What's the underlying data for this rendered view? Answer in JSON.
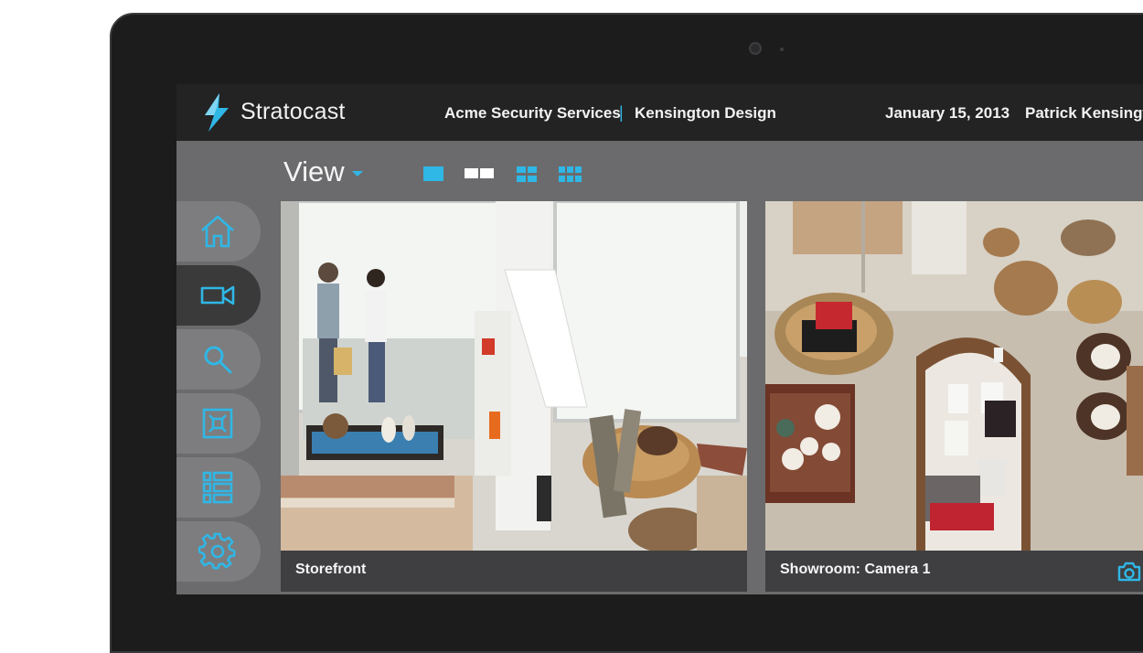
{
  "app": {
    "brand": "Stratocast",
    "organization": "Acme Security Services",
    "separator": "|",
    "site": "Kensington Design",
    "date": "January 15, 2013",
    "user": "Patrick Kensingto"
  },
  "viewbar": {
    "label": "View",
    "layouts": [
      "single-layout-icon",
      "two-column-layout-icon",
      "quad-layout-icon",
      "multi-grid-layout-icon"
    ]
  },
  "sidebar": {
    "items": [
      {
        "name": "home",
        "icon": "home-icon",
        "active": false
      },
      {
        "name": "video",
        "icon": "video-camera-icon",
        "active": true
      },
      {
        "name": "search",
        "icon": "search-icon",
        "active": false
      },
      {
        "name": "map",
        "icon": "focus-frame-icon",
        "active": false
      },
      {
        "name": "list",
        "icon": "list-icon",
        "active": false
      },
      {
        "name": "settings",
        "icon": "gear-icon",
        "active": false
      }
    ]
  },
  "tiles": [
    {
      "caption": "Storefront"
    },
    {
      "caption": "Showroom: Camera 1",
      "action_icon": "snapshot-camera-icon"
    }
  ],
  "colors": {
    "accent": "#2fb7e6",
    "topbar": "#232324",
    "panel": "#6b6b6d",
    "caption": "#3f3f41"
  }
}
